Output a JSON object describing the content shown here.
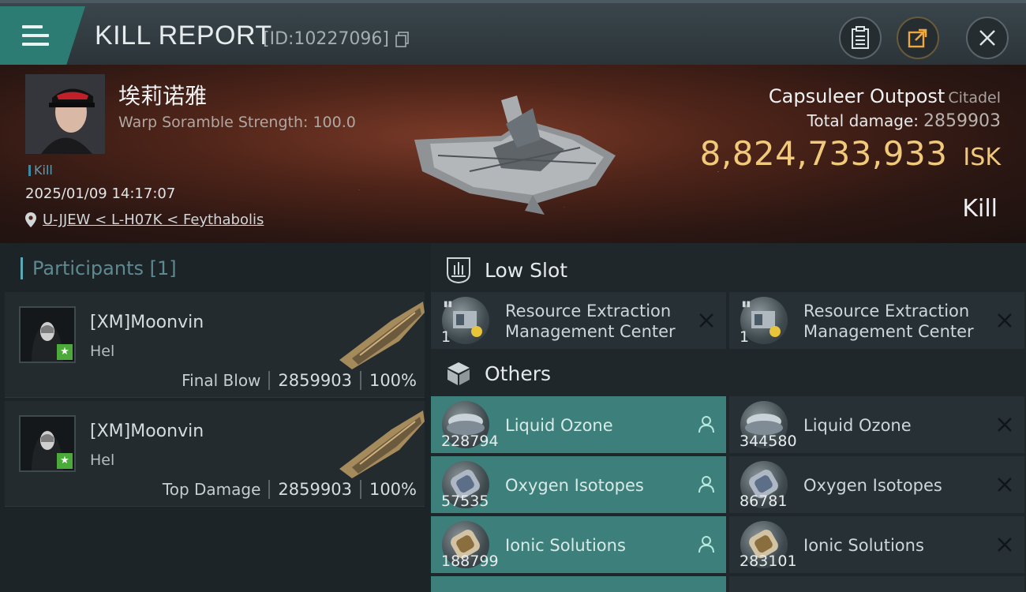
{
  "header": {
    "title": "KILL REPORT",
    "report_id": "[ID:10227096]",
    "buttons": [
      "clipboard-icon",
      "share-icon",
      "close-icon"
    ]
  },
  "victim": {
    "name": "埃莉诺雅",
    "scramble": "Warp Soramble Strength: 100.0",
    "tag": "Kill",
    "datetime": "2025/01/09 14:17:07",
    "location": "U-JJEW < L-H07K < Feythabolis"
  },
  "target": {
    "name": "Capsuleer Outpost",
    "type": "Citadel",
    "total_damage_label": "Total damage:",
    "total_damage": "2859903",
    "isk_value": "8,824,733,933",
    "isk_unit": "ISK",
    "result": "Kill"
  },
  "participants": {
    "title": "Participants [1]",
    "list": [
      {
        "name": "[XM]Moonvin",
        "ship": "Hel",
        "role": "Final Blow",
        "damage": "2859903",
        "percent": "100%"
      },
      {
        "name": "[XM]Moonvin",
        "ship": "Hel",
        "role": "Top Damage",
        "damage": "2859903",
        "percent": "100%"
      }
    ]
  },
  "sections": {
    "low_slot": {
      "label": "Low Slot",
      "items": [
        {
          "qty": "1",
          "name_line1": "Resource Extraction",
          "name_line2": "Management Center",
          "status": "destroyed"
        },
        {
          "qty": "1",
          "name_line1": "Resource Extraction",
          "name_line2": "Management Center",
          "status": "destroyed"
        }
      ]
    },
    "others": {
      "label": "Others",
      "items": [
        {
          "qty": "228794",
          "name": "Liquid Ozone",
          "status": "dropped"
        },
        {
          "qty": "344580",
          "name": "Liquid Ozone",
          "status": "destroyed"
        },
        {
          "qty": "57535",
          "name": "Oxygen Isotopes",
          "status": "dropped"
        },
        {
          "qty": "86781",
          "name": "Oxygen Isotopes",
          "status": "destroyed"
        },
        {
          "qty": "188799",
          "name": "Ionic Solutions",
          "status": "dropped"
        },
        {
          "qty": "283101",
          "name": "Ionic Solutions",
          "status": "destroyed"
        }
      ]
    }
  },
  "colors": {
    "accent": "#3d7f7a",
    "isk": "#f1c97a",
    "bg": "#1d2428"
  }
}
